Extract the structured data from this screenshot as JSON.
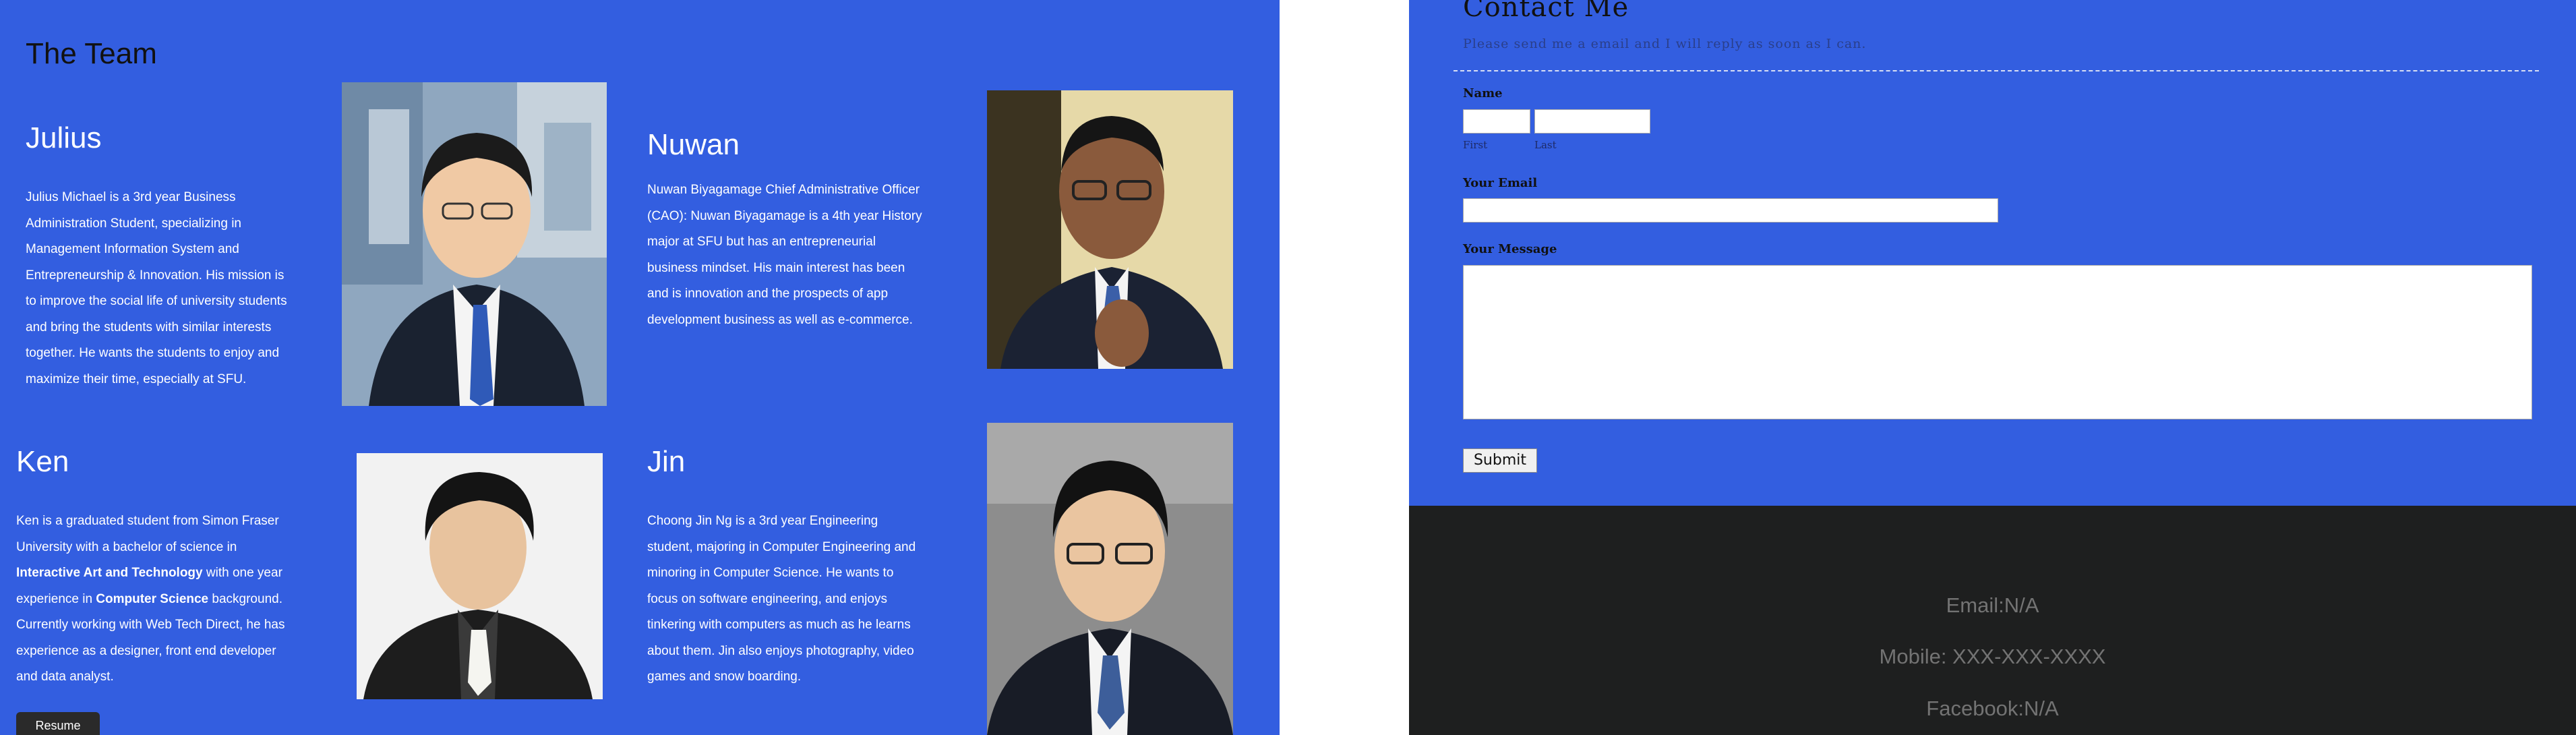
{
  "team": {
    "heading": "The Team",
    "members": [
      {
        "name": "Julius",
        "bio_lines": [
          "Julius Michael is a 3rd year Business",
          "Administration Student, specializing in",
          "Management Information System and",
          "Entrepreneurship & Innovation. His mission is",
          "to improve the social life of university students",
          "and bring the students with similar interests",
          "together. He wants the students to enjoy and",
          "maximize their time, especially at SFU."
        ]
      },
      {
        "name": "Nuwan",
        "bio_lines": [
          "Nuwan Biyagamage Chief Administrative Officer",
          "(CAO): Nuwan Biyagamage is a 4th year History",
          "major at SFU but has an entrepreneurial",
          "business mindset. His main interest has been",
          "and is innovation and the prospects of app",
          "development business as well as e-commerce."
        ]
      },
      {
        "name": "Ken",
        "bio": {
          "l1": "Ken is a graduated student from Simon Fraser",
          "l2": "University with a bachelor of science in",
          "l3_bold": "Interactive Art and Technology",
          "l3_rest": " with one year",
          "l4_a": "experience in ",
          "l4_bold": "Computer Science",
          "l4_rest": " background.",
          "l5": "Currently working with Web Tech Direct, he has",
          "l6": "experience as a designer, front end developer",
          "l7": "and data analyst."
        }
      },
      {
        "name": "Jin",
        "bio_lines": [
          "Choong Jin Ng is a 3rd year Engineering",
          "student, majoring in Computer Engineering and",
          "minoring in Computer Science. He wants to",
          "focus on software engineering, and enjoys",
          "tinkering with computers as much as he learns",
          "about them. Jin also enjoys photography, video",
          "games and snow boarding."
        ]
      }
    ],
    "resume_label": "Resume"
  },
  "contact": {
    "title": "Contact Me",
    "subtitle": "Please send me a email and I will reply as soon as I can.",
    "name_label": "Name",
    "first_hint": "First",
    "last_hint": "Last",
    "first_value": "",
    "last_value": "",
    "email_label": "Your Email",
    "email_value": "",
    "message_label": "Your Message",
    "message_value": "",
    "submit_label": "Submit"
  },
  "footer": {
    "email": "Email:N/A",
    "mobile": "Mobile: XXX-XXX-XXXX",
    "facebook": "Facebook:N/A"
  },
  "colors": {
    "panel_blue": "#335ee0",
    "footer_dark": "#1e1f1f",
    "footer_text": "#737373"
  }
}
